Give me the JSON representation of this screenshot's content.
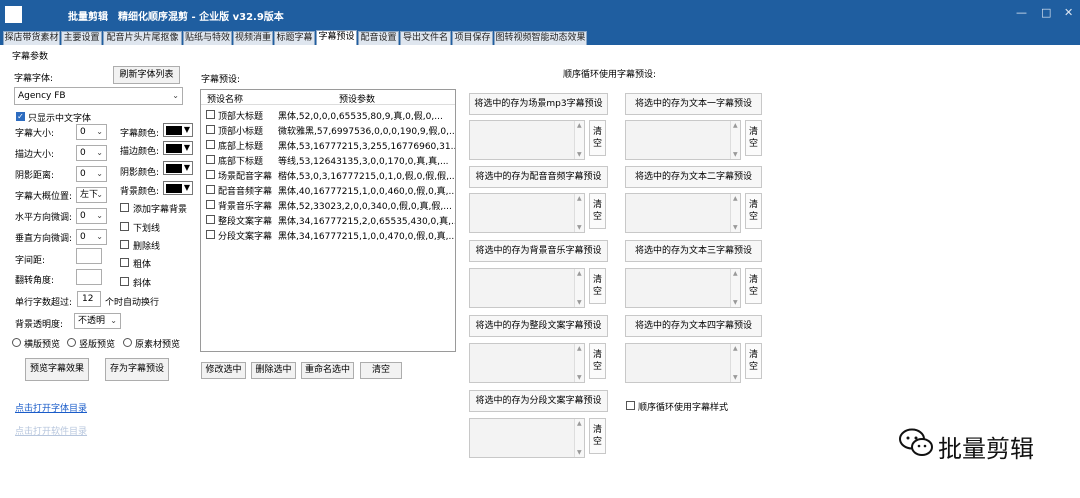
{
  "window": {
    "app_name": "批量剪辑",
    "title": "精细化顺序混剪 - 企业版  v32.9版本",
    "minimize": "—",
    "maximize": "□",
    "close": "✕"
  },
  "tabs": [
    "探店带货素材",
    "主要设置",
    "配音片头片尾抠像",
    "贴纸与特效",
    "视频消重",
    "标题字幕",
    "字幕预设",
    "配音设置",
    "导出文件名",
    "项目保存",
    "图转视频智能动态效果"
  ],
  "active_tab": "字幕预设",
  "left": {
    "section_title": "字幕参数",
    "font_label": "字幕字体:",
    "refresh_button": "刷新字体列表",
    "font_value": "Agency FB",
    "only_chinese_label": "只显示中文字体",
    "only_chinese_checked": true,
    "size_label": "字幕大小:",
    "size_value": "0",
    "stroke_size_label": "描边大小:",
    "stroke_size_value": "0",
    "shadow_dist_label": "阴影距离:",
    "shadow_dist_value": "0",
    "position_label": "字幕大概位置:",
    "position_value": "左下",
    "h_adjust_label": "水平方向微调:",
    "h_adjust_value": "0",
    "v_adjust_label": "垂直方向微调:",
    "v_adjust_value": "0",
    "spacing_label": "字间距:",
    "spacing_value": "",
    "rotate_label": "翻转角度:",
    "rotate_value": "",
    "wrap_prefix": "单行字数超过:",
    "wrap_value": "12",
    "wrap_suffix": "个时自动换行",
    "bg_opacity_label": "背景透明度:",
    "bg_opacity_value": "不透明",
    "color_label": "字幕颜色:",
    "stroke_color_label": "描边颜色:",
    "shadow_color_label": "阴影颜色:",
    "bg_color_label": "背景颜色:",
    "color_value": "#000000",
    "stroke_color_value": "#000000",
    "shadow_color_value": "#000000",
    "bg_color_value": "#000000",
    "add_bg_label": "添加字幕背景",
    "underline_label": "下划线",
    "strike_label": "删除线",
    "bold_label": "粗体",
    "italic_label": "斜体",
    "preview_landscape": "横版预览",
    "preview_portrait": "竖版预览",
    "preview_original": "原素材预览",
    "preview_button": "预览字幕效果",
    "save_preset_button": "存为字幕预设",
    "open_font_dir": "点击打开字体目录",
    "open_soft_dir": "点击打开软件目录"
  },
  "presets": {
    "title": "字幕预设:",
    "col_name": "预设名称",
    "col_params": "预设参数",
    "rows": [
      {
        "name": "顶部大标题",
        "params": "黑体,52,0,0,0,65535,80,9,真,0,假,0,..."
      },
      {
        "name": "顶部小标题",
        "params": "微软雅黑,57,6997536,0,0,0,190,9,假,0,..."
      },
      {
        "name": "底部上标题",
        "params": "黑体,53,16777215,3,255,16776960,31..."
      },
      {
        "name": "底部下标题",
        "params": "等线,53,12643135,3,0,0,170,0,真,真,..."
      },
      {
        "name": "场景配音字幕",
        "params": "楷体,53,0,3,16777215,0,1,0,假,0,假,假,..."
      },
      {
        "name": "配音音频字幕",
        "params": "黑体,40,16777215,1,0,0,460,0,假,0,真,..."
      },
      {
        "name": "背景音乐字幕",
        "params": "黑体,52,33023,2,0,0,340,0,假,0,真,假,..."
      },
      {
        "name": "整段文案字幕",
        "params": "黑体,34,16777215,2,0,65535,430,0,真,..."
      },
      {
        "name": "分段文案字幕",
        "params": "黑体,34,16777215,1,0,0,470,0,假,0,真,..."
      }
    ],
    "modify_button": "修改选中",
    "delete_button": "删除选中",
    "rename_button": "重命名选中",
    "clear_button": "清空"
  },
  "cycle": {
    "title": "顺序循环使用字幕预设:",
    "save_scene": "将选中的存为场景mp3字幕预设",
    "save_voice": "将选中的存为配音音频字幕预设",
    "save_music": "将选中的存为背景音乐字幕预设",
    "save_whole": "将选中的存为整段文案字幕预设",
    "save_segment": "将选中的存为分段文案字幕预设",
    "save_text1": "将选中的存为文本一字幕预设",
    "save_text2": "将选中的存为文本二字幕预设",
    "save_text3": "将选中的存为文本三字幕预设",
    "save_text4": "将选中的存为文本四字幕预设",
    "clear_label": "清\n空",
    "cycle_style_label": "顺序循环使用字幕样式"
  },
  "watermark": "批量剪辑"
}
